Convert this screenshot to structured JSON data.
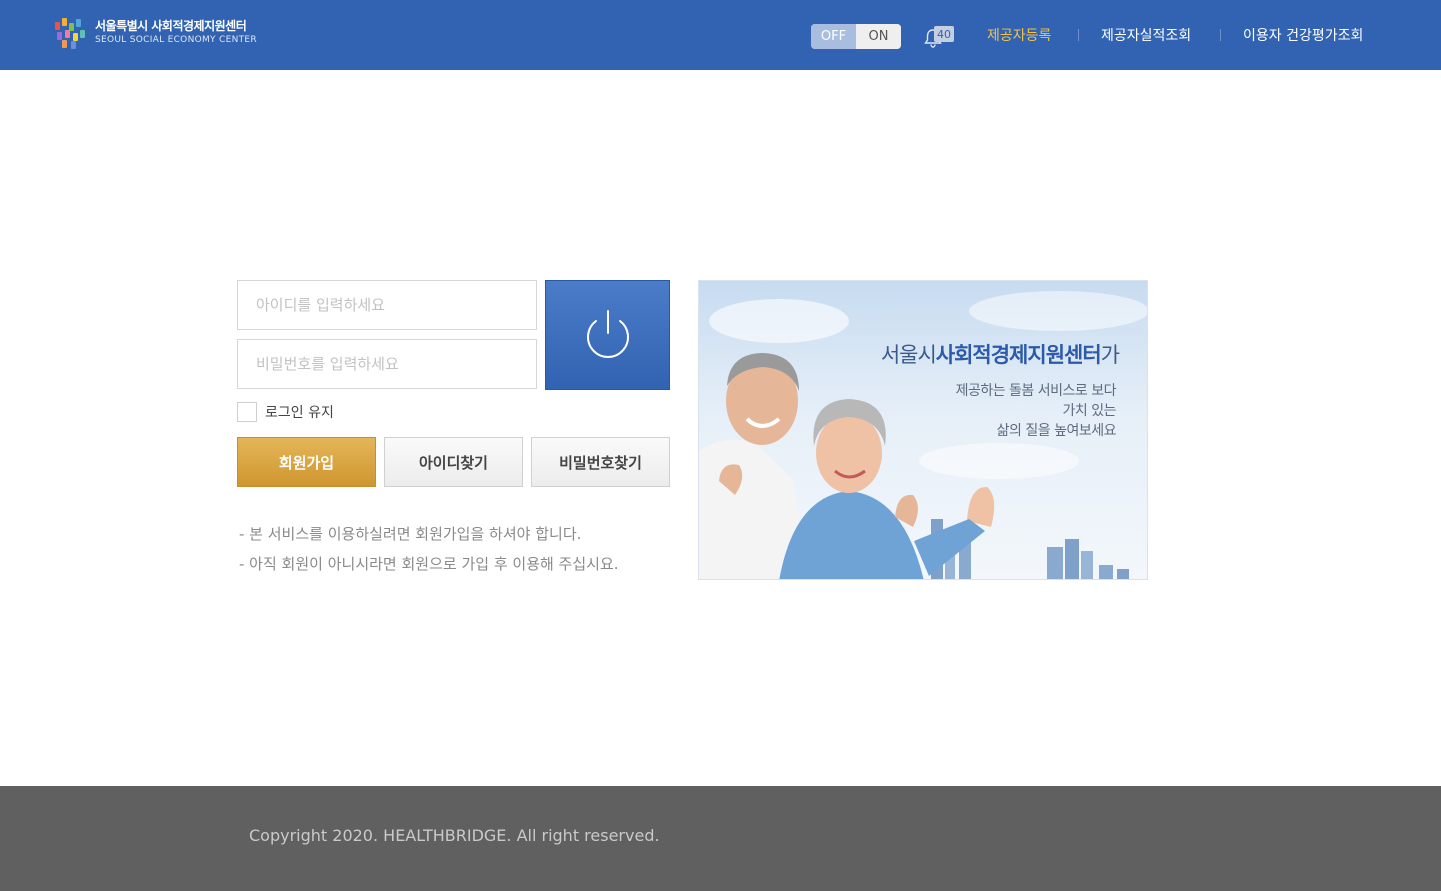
{
  "header": {
    "logo": {
      "korean": "서울특별시 사회적경제지원센터",
      "english": "SEOUL SOCIAL ECONOMY CENTER"
    },
    "toggle": {
      "off_label": "OFF",
      "on_label": "ON",
      "state": "OFF"
    },
    "notifications": {
      "icon": "bell-icon",
      "count": "40"
    },
    "nav": [
      {
        "label": "제공자등록",
        "active": true
      },
      {
        "label": "제공자실적조회",
        "active": false
      },
      {
        "label": "이용자 건강평가조회",
        "active": false
      }
    ]
  },
  "login": {
    "id_placeholder": "아이디를 입력하세요",
    "password_placeholder": "비밀번호를 입력하세요",
    "login_button_icon": "power-icon",
    "keep_login_label": "로그인 유지",
    "keep_login_checked": false,
    "buttons": {
      "signup": "회원가입",
      "find_id": "아이디찾기",
      "find_password": "비밀번호찾기"
    },
    "notices": [
      "- 본 서비스를 이용하실려면 회원가입을 하셔야 합니다.",
      "- 아직 회원이 아니시라면 회원으로 가입 후 이용해 주십시요."
    ]
  },
  "banner": {
    "title_prefix": "서울시",
    "title_bold": "사회적경제지원센터",
    "title_suffix": "가",
    "lines": [
      "제공하는 돌봄 서비스로 보다",
      "가치 있는",
      "삶의 질을 높여보세요"
    ]
  },
  "footer": {
    "copyright": "Copyright 2020. HEALTHBRIDGE. All right reserved."
  },
  "colors": {
    "primary": "#3163b2",
    "accent_gold": "#d9a441",
    "nav_active": "#f2c14e",
    "footer_bg": "#606060"
  }
}
